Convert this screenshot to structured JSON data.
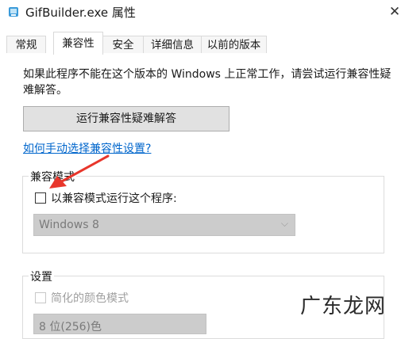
{
  "window": {
    "title": "GifBuilder.exe 属性",
    "close_glyph": "✕",
    "app_icon": "gif-app-icon"
  },
  "tabs": [
    {
      "label": "常规",
      "active": false
    },
    {
      "label": "兼容性",
      "active": true
    },
    {
      "label": "安全",
      "active": false
    },
    {
      "label": "详细信息",
      "active": false
    },
    {
      "label": "以前的版本",
      "active": false
    }
  ],
  "compat": {
    "description": "如果此程序不能在这个版本的 Windows 上正常工作，请尝试运行兼容性疑难解答。",
    "troubleshoot_button": "运行兼容性疑难解答",
    "manual_link": "如何手动选择兼容性设置?"
  },
  "mode_group": {
    "title": "兼容模式",
    "checkbox_label": "以兼容模式运行这个程序:",
    "checkbox_checked": false,
    "select_value": "Windows 8"
  },
  "settings_group": {
    "title": "设置",
    "reduced_color_label": "简化的颜色模式",
    "reduced_color_checked": false,
    "color_select_value": "8 位(256)色"
  },
  "annotation": {
    "arrow_color": "#e8362b"
  },
  "watermark": {
    "text": "广东龙网"
  },
  "colors": {
    "link": "#0066cc",
    "button_bg": "#e1e1e1",
    "disabled_select_bg": "#cccccc"
  }
}
